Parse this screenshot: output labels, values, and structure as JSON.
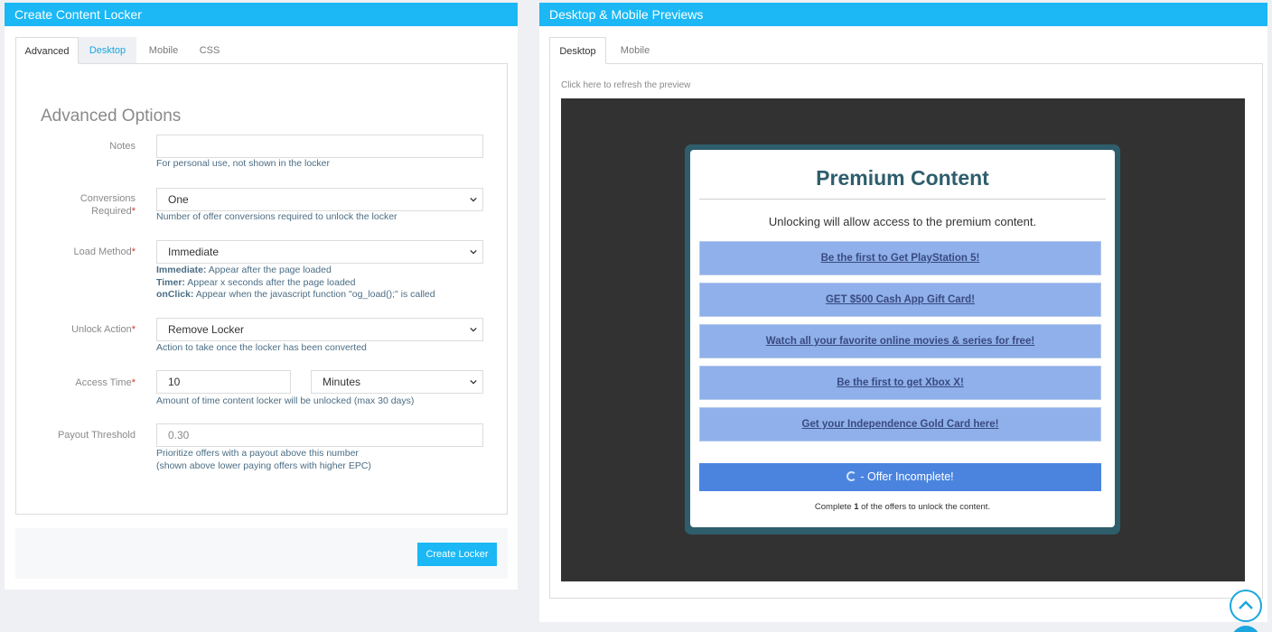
{
  "left_panel": {
    "title": "Create Content Locker",
    "tabs": [
      {
        "label": "Advanced"
      },
      {
        "label": "Desktop"
      },
      {
        "label": "Mobile"
      },
      {
        "label": "CSS"
      }
    ],
    "section_title": "Advanced Options",
    "fields": {
      "notes": {
        "label": "Notes",
        "value": "",
        "help": "For personal use, not shown in the locker"
      },
      "conversions": {
        "label_line1": "Conversions",
        "label_line2": "Required",
        "required_mark": "*",
        "value": "One",
        "help": "Number of offer conversions required to unlock the locker"
      },
      "load_method": {
        "label": "Load Method",
        "required_mark": "*",
        "value": "Immediate",
        "help_lines": [
          {
            "term": "Immediate:",
            "text": " Appear after the page loaded"
          },
          {
            "term": "Timer:",
            "text": " Appear x seconds after the page loaded"
          },
          {
            "term": "onClick:",
            "text": " Appear when the javascript function \"og_load();\" is called"
          }
        ]
      },
      "unlock_action": {
        "label": "Unlock Action",
        "required_mark": "*",
        "value": "Remove Locker",
        "help": "Action to take once the locker has been converted"
      },
      "access_time": {
        "label": "Access Time",
        "required_mark": "*",
        "value": "10",
        "unit": "Minutes",
        "help": "Amount of time content locker will be unlocked (max 30 days)"
      },
      "payout_threshold": {
        "label": "Payout Threshold",
        "placeholder": "0.30",
        "help_line1": "Prioritize offers with a payout above this number",
        "help_line2": "(shown above lower paying offers with higher EPC)"
      }
    },
    "create_button": "Create Locker"
  },
  "right_panel": {
    "title": "Desktop & Mobile Previews",
    "tabs": [
      {
        "label": "Desktop"
      },
      {
        "label": "Mobile"
      }
    ],
    "refresh_link": "Click here to refresh the preview",
    "locker": {
      "title": "Premium Content",
      "description": "Unlocking will allow access to the premium content.",
      "offers": [
        {
          "label": "Be the first to Get PlayStation 5!"
        },
        {
          "label": "GET $500 Cash App Gift Card!"
        },
        {
          "label": "Watch all your favorite online movies & series for free!"
        },
        {
          "label": "Be the first to get Xbox X!"
        },
        {
          "label": "Get your Independence Gold Card here!"
        }
      ],
      "status": "- Offer Incomplete!",
      "complete_prefix": "Complete ",
      "complete_count": "1",
      "complete_suffix": " of the offers to unlock the content."
    }
  },
  "colors": {
    "header_blue": "#1bb8f5",
    "offer_blue": "#8fb0ea",
    "status_blue": "#4a84df",
    "locker_border": "#2e5e6c",
    "preview_bg": "#323232",
    "required_red": "#d9342b"
  },
  "icons": {
    "select_chevron": "chevron-down-icon",
    "spinner": "spinner-icon",
    "scroll_top": "chevron-up-icon"
  }
}
